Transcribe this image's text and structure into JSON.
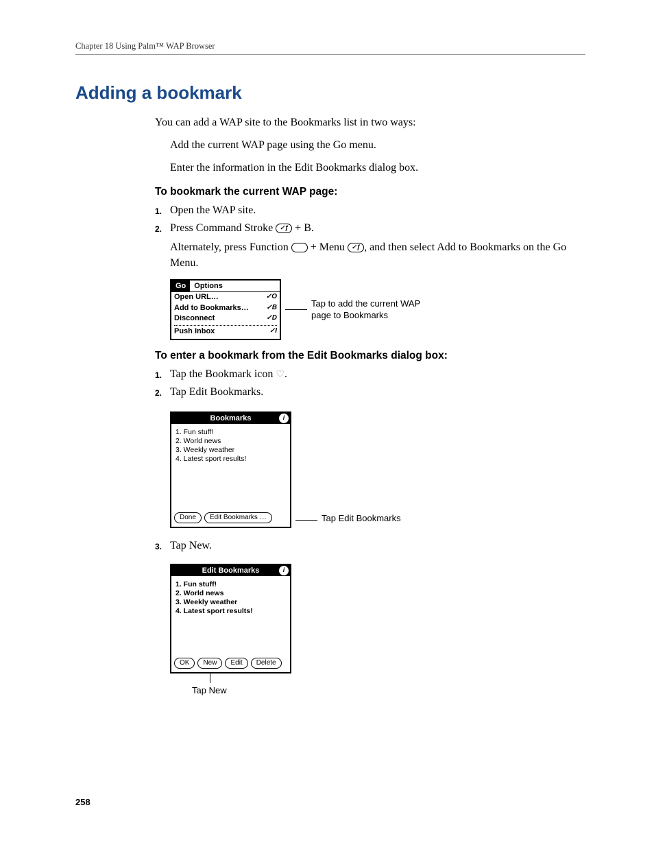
{
  "runningHead": "Chapter 18   Using Palm™ WAP Browser",
  "pageNumber": "258",
  "sectionTitle": "Adding a bookmark",
  "intro": "You can add a WAP site to the Bookmarks list in two ways:",
  "bullets": {
    "b1": "Add the current WAP page using the Go menu.",
    "b2": "Enter the information in the Edit Bookmarks dialog box."
  },
  "subHead1": "To bookmark the current WAP page:",
  "steps1": {
    "s1": "Open the WAP site.",
    "s2a": "Press Command Stroke ",
    "s2b": " + B.",
    "s2follow_a": "Alternately, press Function ",
    "s2follow_b": " + Menu ",
    "s2follow_c": ", and then select Add to Bookmarks on the Go Menu."
  },
  "fig1": {
    "tabs": {
      "go": "Go",
      "options": "Options"
    },
    "items": {
      "openUrl": {
        "label": "Open URL…",
        "short": "✓O"
      },
      "addBk": {
        "label": "Add to Bookmarks…",
        "short": "✓B"
      },
      "disconnect": {
        "label": "Disconnect",
        "short": "✓D"
      },
      "pushInbox": {
        "label": "Push Inbox",
        "short": "✓I"
      }
    },
    "callout": "Tap to add the current WAP page to Bookmarks"
  },
  "subHead2": "To enter a bookmark from the Edit Bookmarks dialog box:",
  "steps2": {
    "s1a": "Tap the Bookmark icon ",
    "s1b": ".",
    "s2": "Tap Edit Bookmarks."
  },
  "fig2": {
    "title": "Bookmarks",
    "items": {
      "i1": "1.  Fun stuff!",
      "i2": "2.  World news",
      "i3": "3.  Weekly weather",
      "i4": "4.  Latest sport results!"
    },
    "buttons": {
      "done": "Done",
      "edit": "Edit Bookmarks …"
    },
    "callout": "Tap Edit Bookmarks"
  },
  "steps3": {
    "s3": "Tap New."
  },
  "fig3": {
    "title": "Edit Bookmarks",
    "items": {
      "i1": "1. Fun stuff!",
      "i2": "2. World news",
      "i3": "3. Weekly weather",
      "i4": "4. Latest sport results!"
    },
    "buttons": {
      "ok": "OK",
      "new": "New",
      "edit": "Edit",
      "delete": "Delete"
    },
    "callout": "Tap New"
  },
  "glyphs": {
    "commandStroke": "✓ƒ",
    "menuStroke": "✓ƒ",
    "heart": "♡"
  }
}
